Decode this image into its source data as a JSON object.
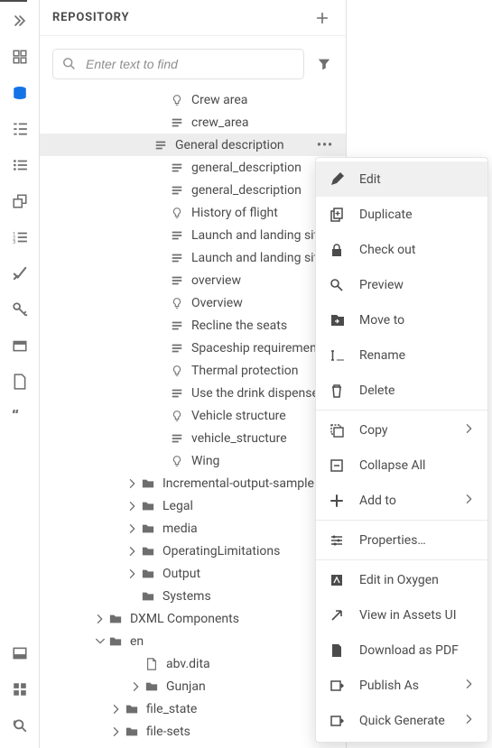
{
  "panel": {
    "title": "REPOSITORY",
    "search_placeholder": "Enter text to find"
  },
  "tree": {
    "topics": [
      {
        "icon": "bulb",
        "label": "Crew area"
      },
      {
        "icon": "topic",
        "label": "crew_area"
      },
      {
        "icon": "topic",
        "label": "General description",
        "selected": true,
        "more": true
      },
      {
        "icon": "topic",
        "label": "general_description"
      },
      {
        "icon": "topic",
        "label": "general_description"
      },
      {
        "icon": "bulb",
        "label": "History of flight"
      },
      {
        "icon": "topic",
        "label": "Launch and landing site"
      },
      {
        "icon": "topic",
        "label": "Launch and landing site"
      },
      {
        "icon": "topic",
        "label": "overview"
      },
      {
        "icon": "bulb",
        "label": "Overview"
      },
      {
        "icon": "topic",
        "label": "Recline the seats"
      },
      {
        "icon": "topic",
        "label": "Spaceship requirements"
      },
      {
        "icon": "bulb",
        "label": "Thermal protection"
      },
      {
        "icon": "topic",
        "label": "Use the drink dispenser"
      },
      {
        "icon": "bulb",
        "label": "Vehicle structure"
      },
      {
        "icon": "topic",
        "label": "vehicle_structure"
      },
      {
        "icon": "bulb",
        "label": "Wing"
      }
    ],
    "folders1": [
      {
        "label": "Incremental-output-sample",
        "chev": true
      },
      {
        "label": "Legal",
        "chev": true
      },
      {
        "label": "media",
        "chev": true
      },
      {
        "label": "OperatingLimitations",
        "chev": true
      },
      {
        "label": "Output",
        "chev": true
      },
      {
        "label": "Systems",
        "chev": false
      }
    ],
    "folders2": [
      {
        "label": "DXML Components",
        "chev": true,
        "indent": 60
      },
      {
        "label": "en",
        "chev": true,
        "indent": 60,
        "open": true
      }
    ],
    "files": [
      {
        "icon": "file",
        "label": "abv.dita",
        "indent": 100,
        "chev_space": true
      },
      {
        "icon": "folder",
        "label": "Gunjan",
        "indent": 100,
        "chev": true
      }
    ],
    "folders3": [
      {
        "label": "file_state",
        "chev": true,
        "indent": 78
      },
      {
        "label": "file-sets",
        "chev": true,
        "indent": 78
      }
    ]
  },
  "ctx": {
    "items": [
      {
        "icon": "edit",
        "label": "Edit",
        "hover": true
      },
      {
        "icon": "duplicate",
        "label": "Duplicate"
      },
      {
        "icon": "lock",
        "label": "Check out"
      },
      {
        "icon": "preview",
        "label": "Preview"
      },
      {
        "icon": "move",
        "label": "Move to"
      },
      {
        "icon": "rename",
        "label": "Rename"
      },
      {
        "icon": "delete",
        "label": "Delete"
      },
      {
        "sep": true
      },
      {
        "icon": "copy",
        "label": "Copy",
        "sub": true
      },
      {
        "icon": "collapse",
        "label": "Collapse All"
      },
      {
        "icon": "add",
        "label": "Add to",
        "sub": true
      },
      {
        "sep": true
      },
      {
        "icon": "properties",
        "label": "Properties…"
      },
      {
        "sep": true
      },
      {
        "icon": "oxygen",
        "label": "Edit in Oxygen"
      },
      {
        "icon": "external",
        "label": "View in Assets UI"
      },
      {
        "icon": "pdf",
        "label": "Download as PDF"
      },
      {
        "icon": "publish",
        "label": "Publish As",
        "sub": true
      },
      {
        "icon": "generate",
        "label": "Quick Generate",
        "sub": true
      }
    ]
  }
}
